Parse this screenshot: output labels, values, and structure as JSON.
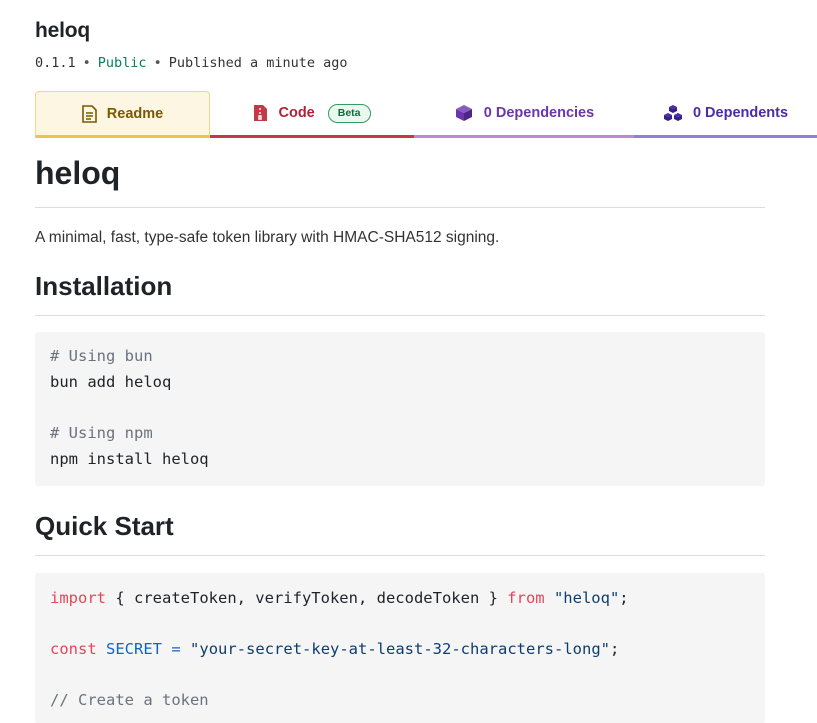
{
  "package": {
    "name": "heloq",
    "version": "0.1.1",
    "visibility": "Public",
    "published": "Published a minute ago"
  },
  "tabs": [
    {
      "label": "Readme",
      "icon": "file-text-icon",
      "active": true
    },
    {
      "label": "Code",
      "icon": "file-code-icon",
      "badge": "Beta"
    },
    {
      "label": "0 Dependencies",
      "icon": "box-icon"
    },
    {
      "label": "0 Dependents",
      "icon": "boxes-icon"
    }
  ],
  "readme": {
    "title": "heloq",
    "description": "A minimal, fast, type-safe token library with HMAC-SHA512 signing.",
    "installation_heading": "Installation",
    "install_code": [
      "# Using bun",
      "bun add heloq",
      "",
      "# Using npm",
      "npm install heloq"
    ],
    "quickstart_heading": "Quick Start",
    "quickstart_code": {
      "import_kw": "import",
      "import_names": " { createToken, verifyToken, decodeToken } ",
      "from_kw": "from",
      "module": "\"heloq\"",
      "semicolon": ";",
      "const_kw": "const",
      "secret_var": "SECRET",
      "equals": "=",
      "secret_value": "\"your-secret-key-at-least-32-characters-long\"",
      "comment": "// Create a token"
    }
  },
  "colors": {
    "readme_accent": "#f0c14b",
    "code_accent": "#c23a48",
    "deps_accent": "#b98ad6",
    "dependents_accent": "#8f7fd8",
    "public": "#0a7f5a"
  }
}
